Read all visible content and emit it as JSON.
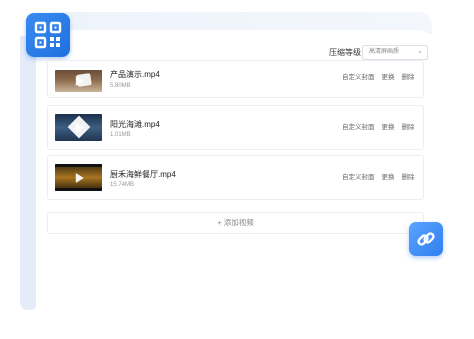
{
  "compress": {
    "label": "压缩等级",
    "value": "高清屏画质"
  },
  "videos": [
    {
      "name": "产品演示.mp4",
      "size": "5.80MB"
    },
    {
      "name": "阳光海滩.mp4",
      "size": "1.01MB"
    },
    {
      "name": "厨禾海鲜餐厅.mp4",
      "size": "15.74MB"
    }
  ],
  "actions": {
    "custom_cover": "自定义封面",
    "replace": "更换",
    "delete": "删除"
  },
  "add_video": "+ 添加视频",
  "icons": {
    "qr": "qr-code-icon",
    "link": "link-icon",
    "play": "play-icon",
    "chevron": "chevron-down-icon"
  },
  "colors": {
    "accent": "#2f7ff0",
    "panel_bg": "#e4ecf9"
  }
}
